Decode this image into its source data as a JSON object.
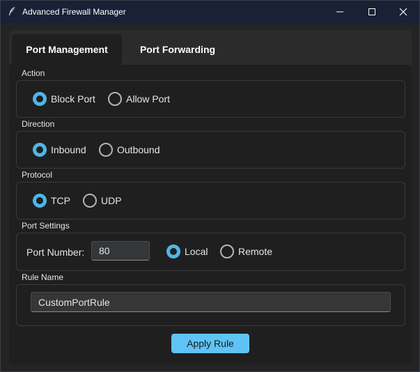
{
  "window": {
    "title": "Advanced Firewall Manager",
    "app_icon": "feather-icon",
    "controls": [
      "minimize-icon",
      "maximize-icon",
      "close-icon"
    ]
  },
  "tabs": [
    {
      "label": "Port Management",
      "active": true
    },
    {
      "label": "Port Forwarding",
      "active": false
    }
  ],
  "action": {
    "label": "Action",
    "options": [
      {
        "label": "Block Port",
        "selected": true
      },
      {
        "label": "Allow Port",
        "selected": false
      }
    ]
  },
  "direction": {
    "label": "Direction",
    "options": [
      {
        "label": "Inbound",
        "selected": true
      },
      {
        "label": "Outbound",
        "selected": false
      }
    ]
  },
  "protocol": {
    "label": "Protocol",
    "options": [
      {
        "label": "TCP",
        "selected": true
      },
      {
        "label": "UDP",
        "selected": false
      }
    ]
  },
  "port_settings": {
    "label": "Port Settings",
    "port_number_label": "Port Number:",
    "port_number_value": "80",
    "scope_options": [
      {
        "label": "Local",
        "selected": true
      },
      {
        "label": "Remote",
        "selected": false
      }
    ]
  },
  "rule_name": {
    "label": "Rule Name",
    "value": "CustomPortRule"
  },
  "apply_button": {
    "label": "Apply Rule"
  },
  "colors": {
    "accent": "#4db6e8",
    "button": "#5fc4f5",
    "titlebar": "#1a2035",
    "background": "#242424"
  }
}
